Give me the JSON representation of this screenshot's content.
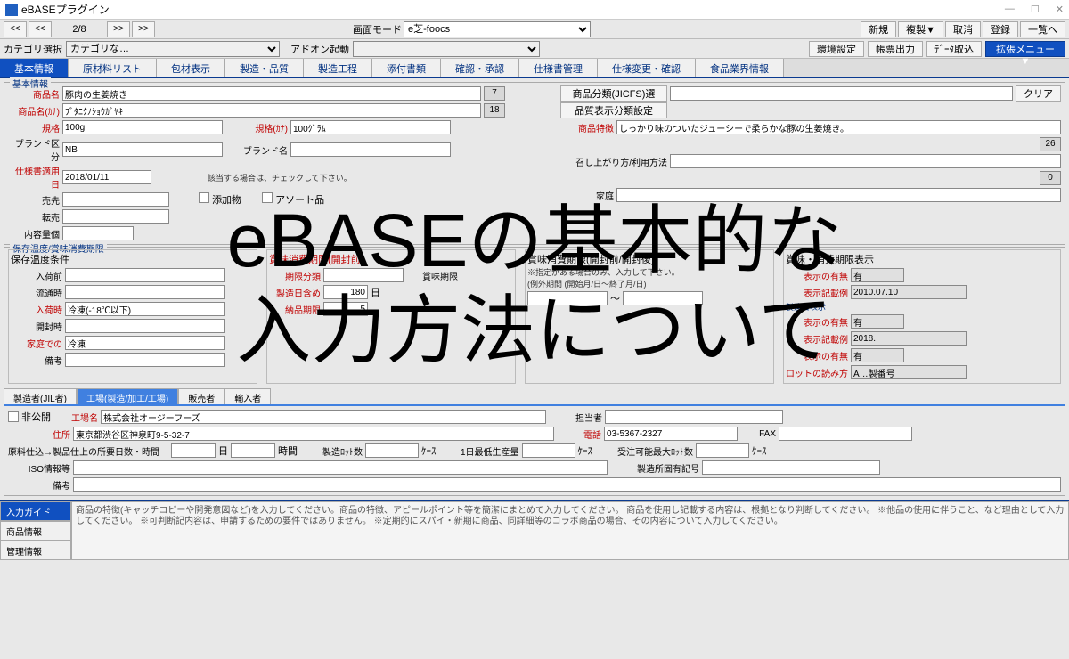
{
  "window": {
    "title": "eBASEプラグイン"
  },
  "nav": {
    "page": "2/8"
  },
  "toprow": {
    "mode_label": "画面モード",
    "mode_value": "e芝-foocs",
    "addon_label": "アドオン起動",
    "btn_new": "新規",
    "btn_copy": "複製▼",
    "btn_get": "取消",
    "btn_reg": "登録",
    "btn_list": "一覧へ",
    "btn_env": "環境設定",
    "btn_out": "帳票出力",
    "btn_imp": "ﾃﾞｰﾀ取込",
    "btn_menu": "拡張メニュー▼"
  },
  "cat": {
    "label": "カテゴリ選択",
    "value": "カテゴリな…"
  },
  "tabs": [
    "基本情報",
    "原材料リスト",
    "包材表示",
    "製造・品質",
    "製造工程",
    "添付書類",
    "確認・承認",
    "仕様書管理",
    "仕様変更・確認",
    "食品業界情報"
  ],
  "basic": {
    "legend": "基本情報",
    "product_name_lbl": "商品名",
    "product_name": "豚肉の生姜焼き",
    "product_name_ct": "7",
    "product_kana_lbl": "商品名(ｶﾅ)",
    "product_kana": "ﾌﾞﾀﾆｸﾉｼｮｳｶﾞﾔｷ",
    "product_kana_ct": "18",
    "spec_lbl": "規格",
    "spec": "100g",
    "spec_kana_lbl": "規格(ｶﾅ)",
    "spec_kana": "100ｸﾞﾗﾑ",
    "brand_div_lbl": "ブランド区分",
    "brand_div": "NB",
    "brand_name_lbl": "ブランド名",
    "apply_date_lbl": "仕様書適用日",
    "apply_date": "2018/01/11",
    "check_note": "該当する場合は、チェックして下さい。",
    "cb1": "添加物",
    "cb2": "アソート品",
    "sale_lbl": "売先",
    "resale_lbl": "転売",
    "qty_lbl": "内容量個"
  },
  "right": {
    "class_lbl": "商品分類(JICFS)選択",
    "clear_btn": "クリア",
    "disp_setting": "品質表示分類設定",
    "feature_lbl": "商品特徴",
    "feature": "しっかり味のついたジューシーで柔らかな豚の生姜焼き。",
    "feature_ct": "26",
    "cook_lbl": "召し上がり方/利用方法",
    "cook_ct": "0",
    "house_lbl": "家庭"
  },
  "storage": {
    "legend": "保存温度/賞味消費期限",
    "cond_legend": "保存温度条件",
    "before_lbl": "入荷前",
    "transit_lbl": "流通時",
    "arrival_lbl": "入荷時",
    "arrival": "冷凍(-18℃以下)",
    "open_lbl": "開封時",
    "home_lbl": "家庭での",
    "home": "冷凍",
    "note_lbl": "備考",
    "mid_legend": "賞味消費期限(開封前)",
    "exp_limit_lbl": "期限分類",
    "exp_unit_lbl": "賞味期限",
    "make_from_lbl": "製造日含め",
    "make_from": "180",
    "make_unit": "日",
    "limit_lbl": "納品期限",
    "limit": "5",
    "mid_note": "賞味消費期限(開封前/開封後)",
    "mid_note2": "※指定がある場合のみ、入力して下さい。",
    "range_lbl": "(例外期間 (開始月/日～終了月/日)",
    "rt_legend": "賞味・消費期限表示",
    "disp_has_lbl": "表示の有無",
    "disp_has": "有",
    "disp_ex_lbl": "表示記載例",
    "disp_ex": "2010.07.10",
    "make_date_legend": "製造日表示",
    "make_has_lbl": "表示の有無",
    "make_has": "有",
    "make_ex_lbl": "表示記載例",
    "make_ex": "2018.",
    "lot_has_lbl": "表示の有無",
    "lot_has": "有",
    "lot_read_lbl": "ロットの読み方",
    "lot_read": "A…製番号"
  },
  "maker": {
    "tabs": [
      "製造者(JIL者)",
      "工場(製造/加工/工場)",
      "販売者",
      "輸入者"
    ],
    "private_lbl": "非公開",
    "factory_lbl": "工場名",
    "factory": "株式会社オージーフーズ",
    "person_lbl": "担当者",
    "addr_lbl": "住所",
    "addr": "東京都渋谷区神泉町9-5-32-7",
    "tel_lbl": "電話",
    "tel": "03-5367-2327",
    "fax_lbl": "FAX",
    "proc_lbl": "原料仕込→製品仕上の所要日数・時間",
    "day_lbl": "日",
    "hr_lbl": "時間",
    "lot_lbl": "製造ﾛｯﾄ数",
    "case_lbl": "ｹｰｽ",
    "daily_lbl": "1日最低生産量",
    "max_lbl": "受注可能最大ﾛｯﾄ数",
    "iso_lbl": "ISO情報等",
    "loc_lbl": "製造所固有記号",
    "note_lbl": "備考"
  },
  "guide": {
    "tabs": [
      "入力ガイド",
      "商品情報",
      "管理情報"
    ],
    "text": "商品の特徴(キャッチコピーや開発意図など)を入力してください。商品の特徴、アピールポイント等を簡潔にまとめて入力してください。\n商品を使用し記載する内容は、根拠となり判断してください。\n※他品の使用に伴うこと、など理由として入力してください。\n※可判断記内容は、申請するための要件ではありません。\n※定期的にスパイ・新期に商品、同詳細等のコラボ商品の場合、その内容について入力してください。"
  },
  "overlay": {
    "l1": "eBASEの基本的な",
    "l2": "入力方法について"
  }
}
